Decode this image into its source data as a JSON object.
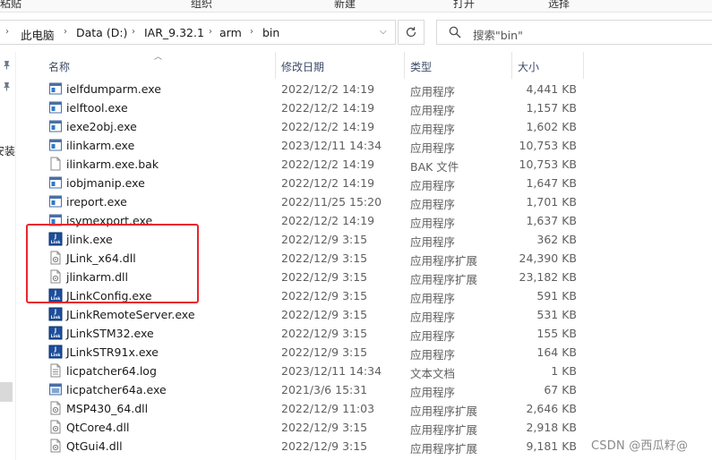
{
  "ribbon": {
    "labels": [
      "粘贴",
      "组织",
      "新建",
      "打开",
      "选择"
    ]
  },
  "address": {
    "crumbs": [
      "此电脑",
      "Data (D:)",
      "IAR_9.32.1",
      "arm",
      "bin"
    ]
  },
  "search": {
    "placeholder": "搜索\"bin\""
  },
  "nav": {
    "fragment": "安装"
  },
  "columns": {
    "name": "名称",
    "date": "修改日期",
    "type": "类型",
    "size": "大小"
  },
  "files": [
    {
      "name": "ielfdumparm.exe",
      "date": "2022/12/2 14:19",
      "type": "应用程序",
      "size": "4,441 KB",
      "icon": "exe-icon"
    },
    {
      "name": "ielftool.exe",
      "date": "2022/12/2 14:19",
      "type": "应用程序",
      "size": "1,157 KB",
      "icon": "exe-icon"
    },
    {
      "name": "iexe2obj.exe",
      "date": "2022/12/2 14:19",
      "type": "应用程序",
      "size": "1,602 KB",
      "icon": "exe-icon"
    },
    {
      "name": "ilinkarm.exe",
      "date": "2023/12/11 14:34",
      "type": "应用程序",
      "size": "10,753 KB",
      "icon": "exe-icon"
    },
    {
      "name": "ilinkarm.exe.bak",
      "date": "2022/12/2 14:19",
      "type": "BAK 文件",
      "size": "10,753 KB",
      "icon": "file-icon"
    },
    {
      "name": "iobjmanip.exe",
      "date": "2022/12/2 14:19",
      "type": "应用程序",
      "size": "1,647 KB",
      "icon": "exe-icon"
    },
    {
      "name": "ireport.exe",
      "date": "2022/11/25 15:20",
      "type": "应用程序",
      "size": "1,701 KB",
      "icon": "exe-icon"
    },
    {
      "name": "isymexport.exe",
      "date": "2022/12/2 14:19",
      "type": "应用程序",
      "size": "1,637 KB",
      "icon": "exe-icon"
    },
    {
      "name": "jlink.exe",
      "date": "2022/12/9 3:15",
      "type": "应用程序",
      "size": "362 KB",
      "icon": "jlink-icon"
    },
    {
      "name": "JLink_x64.dll",
      "date": "2022/12/9 3:15",
      "type": "应用程序扩展",
      "size": "24,390 KB",
      "icon": "dll-icon"
    },
    {
      "name": "jlinkarm.dll",
      "date": "2022/12/9 3:15",
      "type": "应用程序扩展",
      "size": "23,182 KB",
      "icon": "dll-icon"
    },
    {
      "name": "JLinkConfig.exe",
      "date": "2022/12/9 3:15",
      "type": "应用程序",
      "size": "591 KB",
      "icon": "jlink-icon"
    },
    {
      "name": "JLinkRemoteServer.exe",
      "date": "2022/12/9 3:15",
      "type": "应用程序",
      "size": "531 KB",
      "icon": "jlink-icon"
    },
    {
      "name": "JLinkSTM32.exe",
      "date": "2022/12/9 3:15",
      "type": "应用程序",
      "size": "155 KB",
      "icon": "jlink-icon"
    },
    {
      "name": "JLinkSTR91x.exe",
      "date": "2022/12/9 3:15",
      "type": "应用程序",
      "size": "164 KB",
      "icon": "jlink-icon"
    },
    {
      "name": "licpatcher64.log",
      "date": "2023/12/11 14:34",
      "type": "文本文档",
      "size": "1 KB",
      "icon": "text-file-icon"
    },
    {
      "name": "licpatcher64a.exe",
      "date": "2021/3/6 15:31",
      "type": "应用程序",
      "size": "67 KB",
      "icon": "patcher-icon"
    },
    {
      "name": "MSP430_64.dll",
      "date": "2022/12/9 11:03",
      "type": "应用程序扩展",
      "size": "2,646 KB",
      "icon": "dll-icon"
    },
    {
      "name": "QtCore4.dll",
      "date": "2022/12/9 3:15",
      "type": "应用程序扩展",
      "size": "2,918 KB",
      "icon": "dll-icon"
    },
    {
      "name": "QtGui4.dll",
      "date": "2022/12/9 3:15",
      "type": "应用程序扩展",
      "size": "9,181 KB",
      "icon": "dll-icon"
    }
  ],
  "watermark": "CSDN @西瓜籽@",
  "colors": {
    "highlight": "#e8262c",
    "jlink_blue": "#1d4f9c"
  }
}
